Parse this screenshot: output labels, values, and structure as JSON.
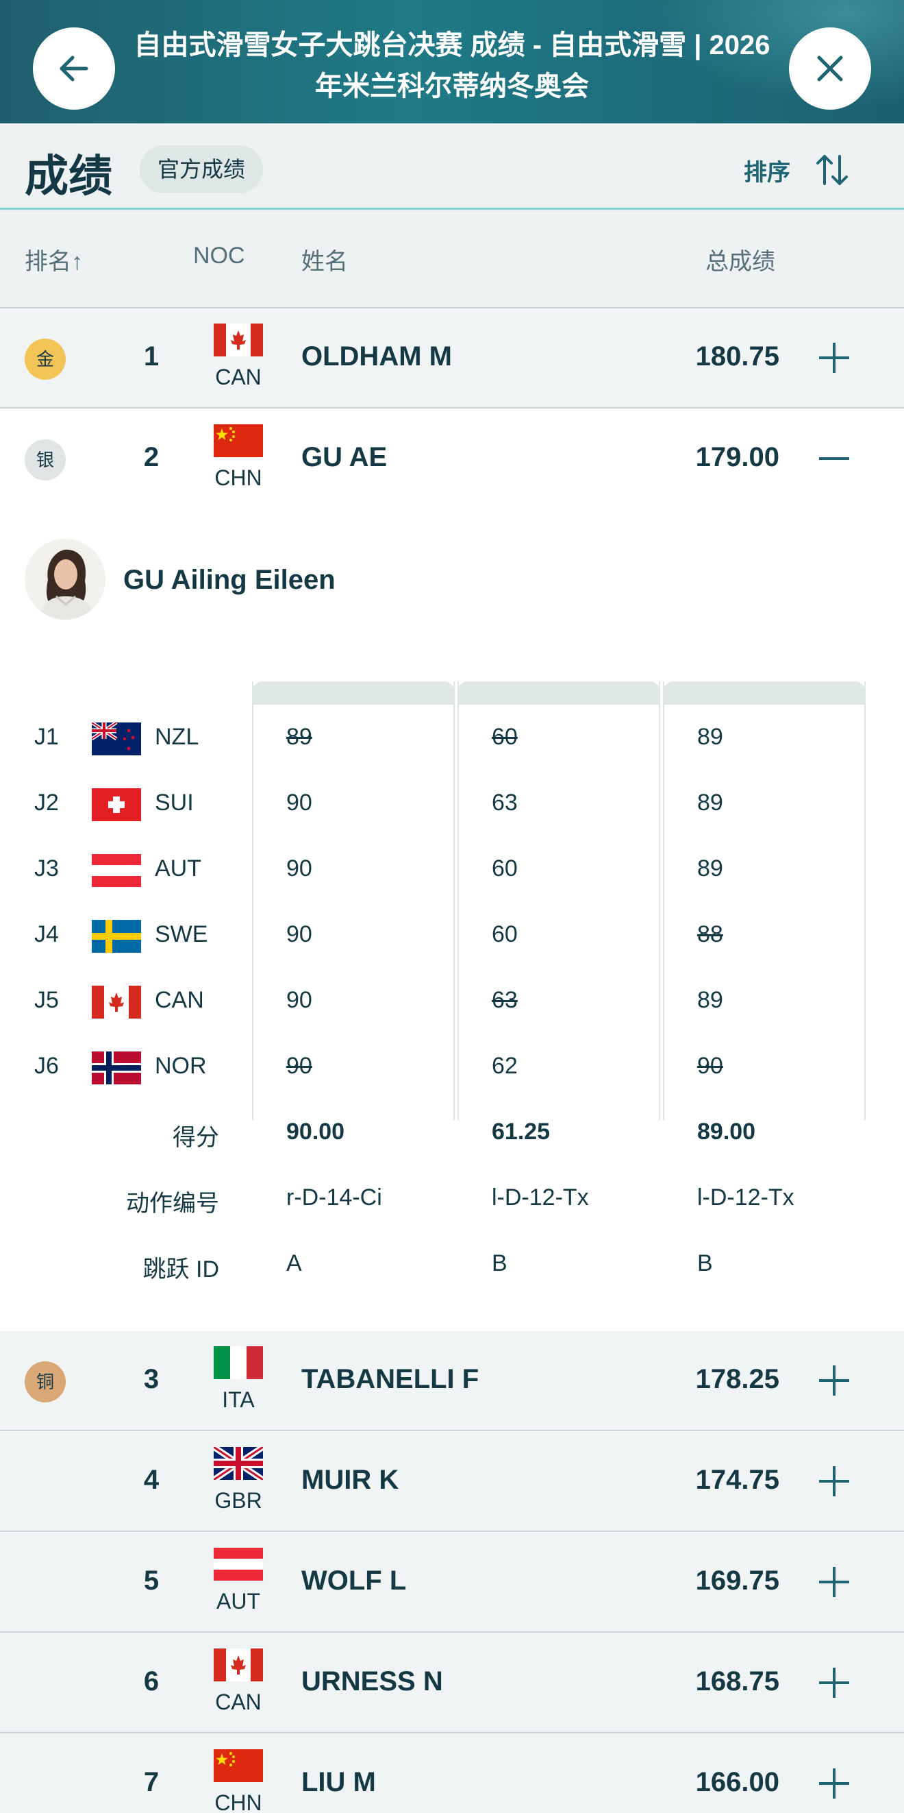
{
  "header": {
    "title": "自由式滑雪女子大跳台决赛 成绩 - 自由式滑雪 | 2026年米兰科尔蒂纳冬奥会",
    "back_icon": "arrow-left-icon",
    "close_icon": "close-icon"
  },
  "results_bar": {
    "title": "成绩",
    "chip": "官方成绩",
    "sort_label": "排序",
    "sort_icon": "sort-arrows-icon"
  },
  "columns": {
    "rank": "排名↑",
    "noc": "NOC",
    "name": "姓名",
    "total": "总成绩"
  },
  "colors": {
    "header_bg": "#1f6f7d",
    "accent": "#1e6472",
    "gold": "#f3c457",
    "silver": "#e2e5e6",
    "bronze": "#d9a877"
  },
  "rows": [
    {
      "medal": "金",
      "rank": "1",
      "noc": "CAN",
      "name": "OLDHAM M",
      "total": "180.75",
      "toggle": "+"
    },
    {
      "medal": "银",
      "rank": "2",
      "noc": "CHN",
      "name": "GU AE",
      "total": "179.00",
      "toggle": "−"
    },
    {
      "medal": "铜",
      "rank": "3",
      "noc": "ITA",
      "name": "TABANELLI F",
      "total": "178.25",
      "toggle": "+"
    },
    {
      "medal": "",
      "rank": "4",
      "noc": "GBR",
      "name": "MUIR K",
      "total": "174.75",
      "toggle": "+"
    },
    {
      "medal": "",
      "rank": "5",
      "noc": "AUT",
      "name": "WOLF L",
      "total": "169.75",
      "toggle": "+"
    },
    {
      "medal": "",
      "rank": "6",
      "noc": "CAN",
      "name": "URNESS N",
      "total": "168.75",
      "toggle": "+"
    },
    {
      "medal": "",
      "rank": "7",
      "noc": "CHN",
      "name": "LIU M",
      "total": "166.00",
      "toggle": "+"
    }
  ],
  "detail": {
    "full_name": "GU Ailing Eileen",
    "judges": [
      {
        "code": "J1",
        "noc": "NZL",
        "scores": [
          "89",
          "60",
          "89"
        ],
        "struck": [
          true,
          true,
          false
        ]
      },
      {
        "code": "J2",
        "noc": "SUI",
        "scores": [
          "90",
          "63",
          "89"
        ],
        "struck": [
          false,
          false,
          false
        ]
      },
      {
        "code": "J3",
        "noc": "AUT",
        "scores": [
          "90",
          "60",
          "89"
        ],
        "struck": [
          false,
          false,
          false
        ]
      },
      {
        "code": "J4",
        "noc": "SWE",
        "scores": [
          "90",
          "60",
          "88"
        ],
        "struck": [
          false,
          false,
          true
        ]
      },
      {
        "code": "J5",
        "noc": "CAN",
        "scores": [
          "90",
          "63",
          "89"
        ],
        "struck": [
          false,
          true,
          false
        ]
      },
      {
        "code": "J6",
        "noc": "NOR",
        "scores": [
          "90",
          "62",
          "90"
        ],
        "struck": [
          true,
          false,
          true
        ]
      }
    ],
    "score_label": "得分",
    "scores": [
      "90.00",
      "61.25",
      "89.00"
    ],
    "trick_label": "动作编号",
    "tricks": [
      "r-D-14-Ci",
      "l-D-12-Tx",
      "l-D-12-Tx"
    ],
    "jump_label": "跳跃 ID",
    "jumps": [
      "A",
      "B",
      "B"
    ]
  }
}
